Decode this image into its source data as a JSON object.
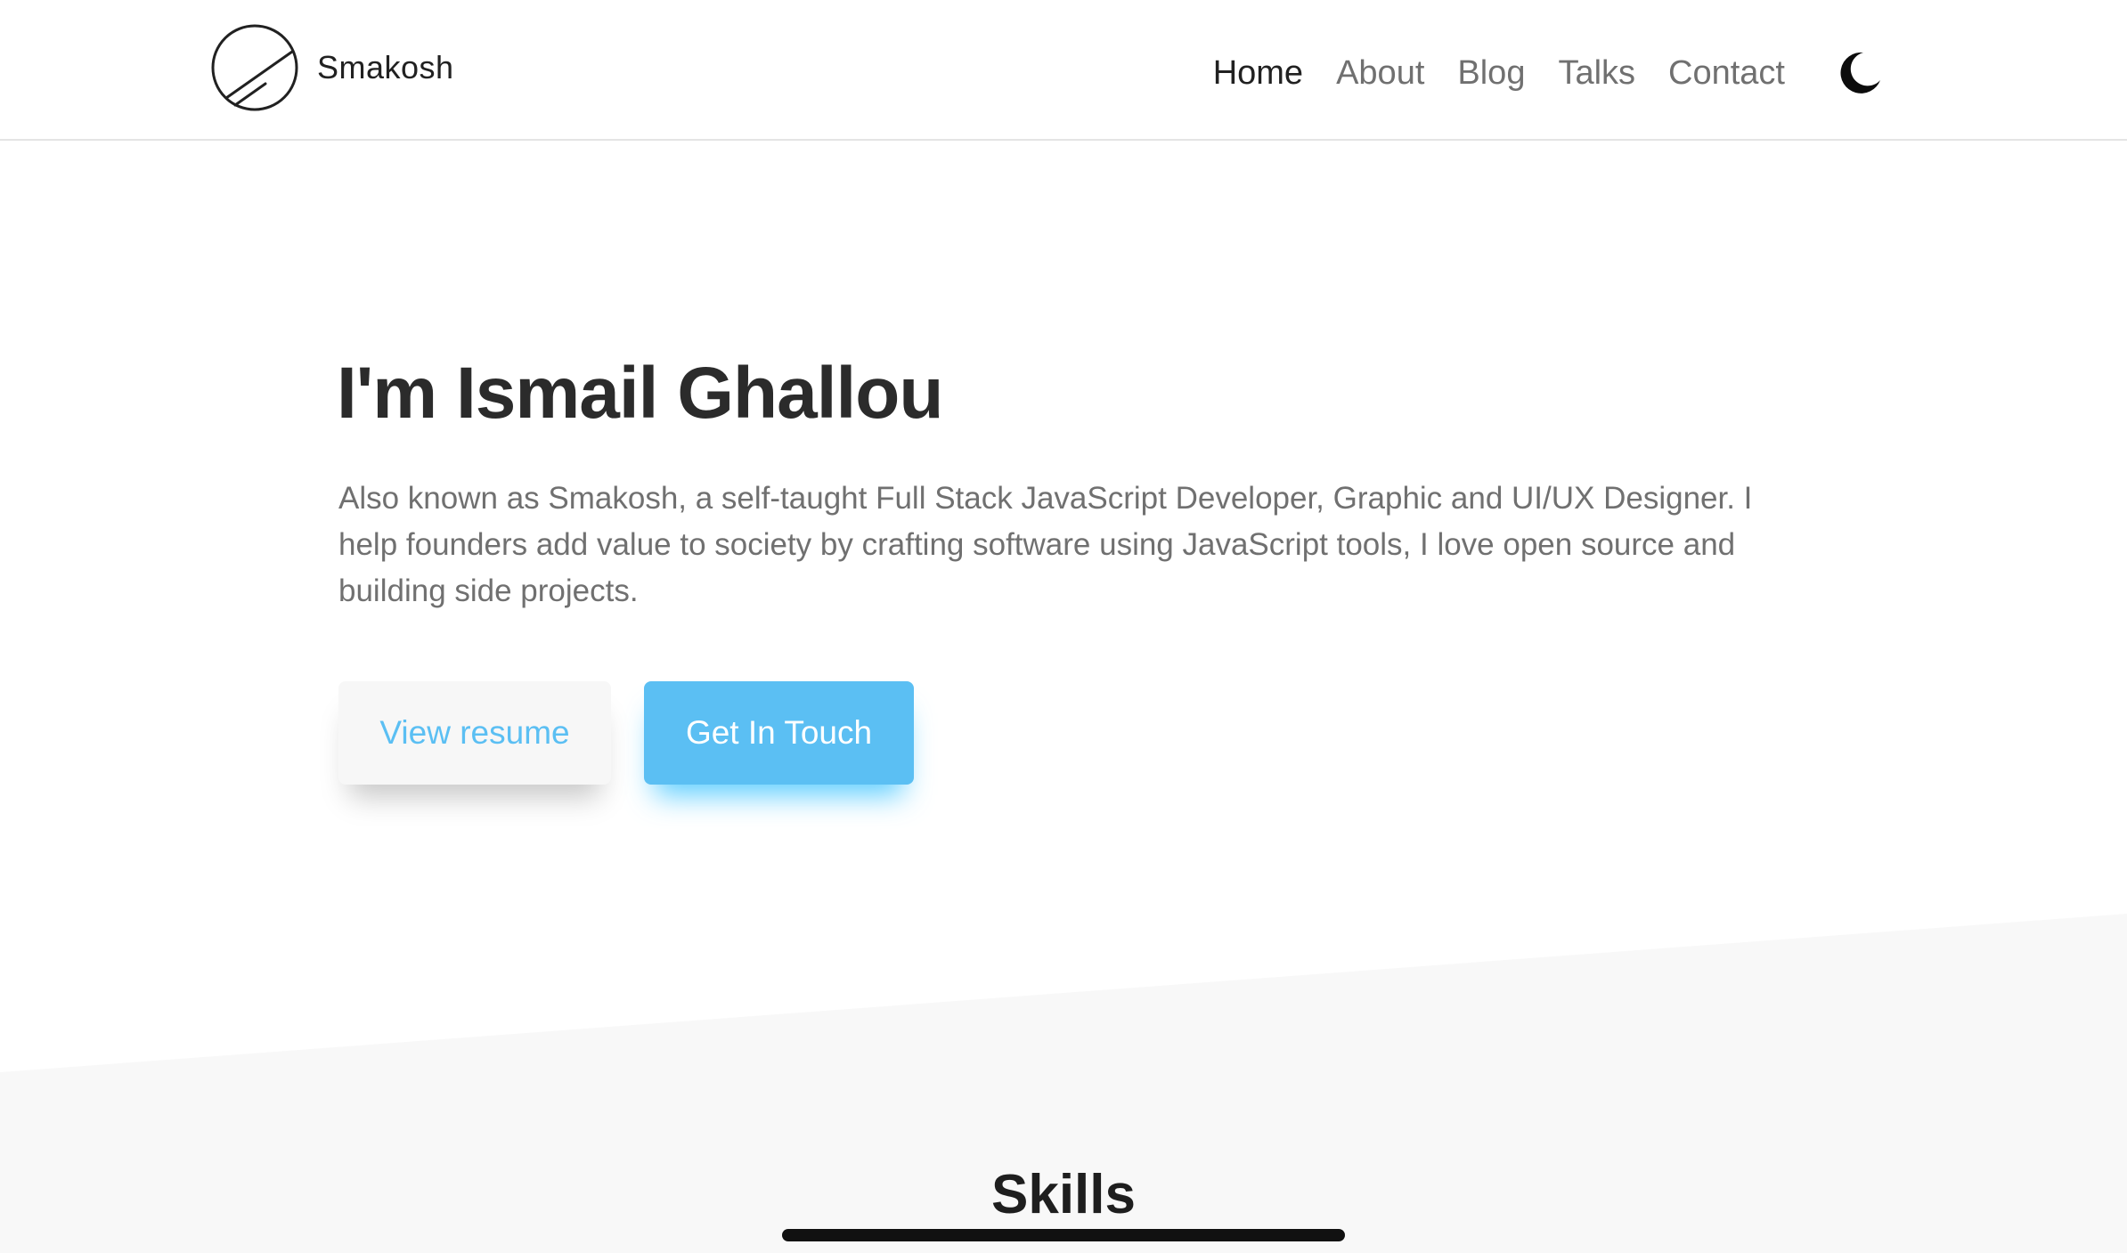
{
  "brand": {
    "name": "Smakosh",
    "logo_icon": "smakosh-logo-icon"
  },
  "nav": {
    "items": [
      {
        "label": "Home",
        "active": true
      },
      {
        "label": "About",
        "active": false
      },
      {
        "label": "Blog",
        "active": false
      },
      {
        "label": "Talks",
        "active": false
      },
      {
        "label": "Contact",
        "active": false
      }
    ],
    "theme_toggle_icon": "moon-icon"
  },
  "hero": {
    "title": "I'm Ismail Ghallou",
    "description": "Also known as Smakosh, a self-taught Full Stack JavaScript Developer, Graphic and UI/UX Designer. I help founders add value to society by crafting software using JavaScript tools, I love open source and building side projects.",
    "buttons": {
      "resume": "View resume",
      "contact": "Get In Touch"
    }
  },
  "skills": {
    "title": "Skills"
  },
  "colors": {
    "accent": "#5bbff3",
    "section_bg": "#f8f8f8",
    "text_dark": "#2b2b2b",
    "text_muted": "#707070"
  }
}
